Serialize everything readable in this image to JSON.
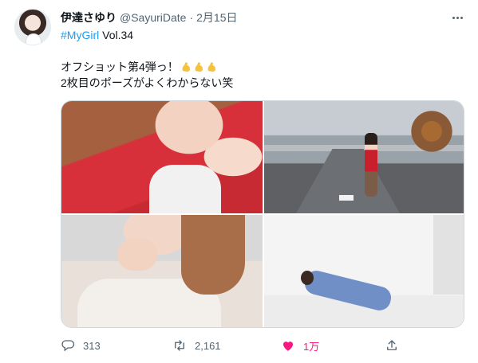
{
  "tweet": {
    "author_name": "伊達さゆり",
    "author_handle": "@SayuriDate",
    "separator": "·",
    "date": "2月15日",
    "hashtag": "#MyGirl",
    "hashtag_suffix": " Vol.34",
    "text_line1": "オフショット第4弾っ！",
    "text_line2": "2枚目のポーズがよくわからない笑",
    "emoji_names": [
      "flexed-biceps",
      "flexed-biceps",
      "flexed-biceps"
    ],
    "media_count": 4
  },
  "actions": {
    "reply_count": "313",
    "retweet_count": "2,161",
    "like_count": "1万",
    "liked": true
  },
  "colors": {
    "link": "#1d9bf0",
    "secondary_text": "#536471",
    "like_active": "#f91880",
    "emoji": "#f4c23c"
  }
}
